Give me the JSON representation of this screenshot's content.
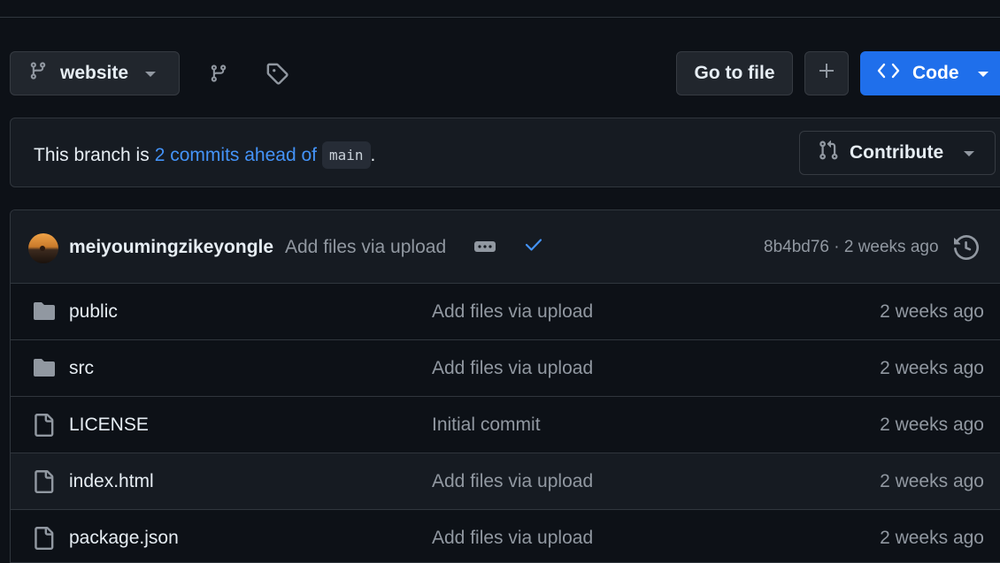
{
  "toolbar": {
    "branch_name": "website",
    "goto_file_label": "Go to file",
    "code_label": "Code"
  },
  "branch_status": {
    "prefix": "This branch is",
    "link_text": "2 commits ahead of",
    "base_branch": "main",
    "suffix": ".",
    "contribute_label": "Contribute"
  },
  "latest_commit": {
    "author": "meiyoumingzikeyongle",
    "message": "Add files via upload",
    "sha_time": "8b4bd76 · 2 weeks ago"
  },
  "files": [
    {
      "type": "folder",
      "name": "public",
      "message": "Add files via upload",
      "time": "2 weeks ago"
    },
    {
      "type": "folder",
      "name": "src",
      "message": "Add files via upload",
      "time": "2 weeks ago"
    },
    {
      "type": "file",
      "name": "LICENSE",
      "message": "Initial commit",
      "time": "2 weeks ago"
    },
    {
      "type": "file",
      "name": "index.html",
      "message": "Add files via upload",
      "time": "2 weeks ago"
    },
    {
      "type": "file",
      "name": "package.json",
      "message": "Add files via upload",
      "time": "2 weeks ago"
    }
  ],
  "colors": {
    "background": "#0d1117",
    "accent": "#1f6feb",
    "link": "#4493f8",
    "muted": "#9198a1"
  }
}
